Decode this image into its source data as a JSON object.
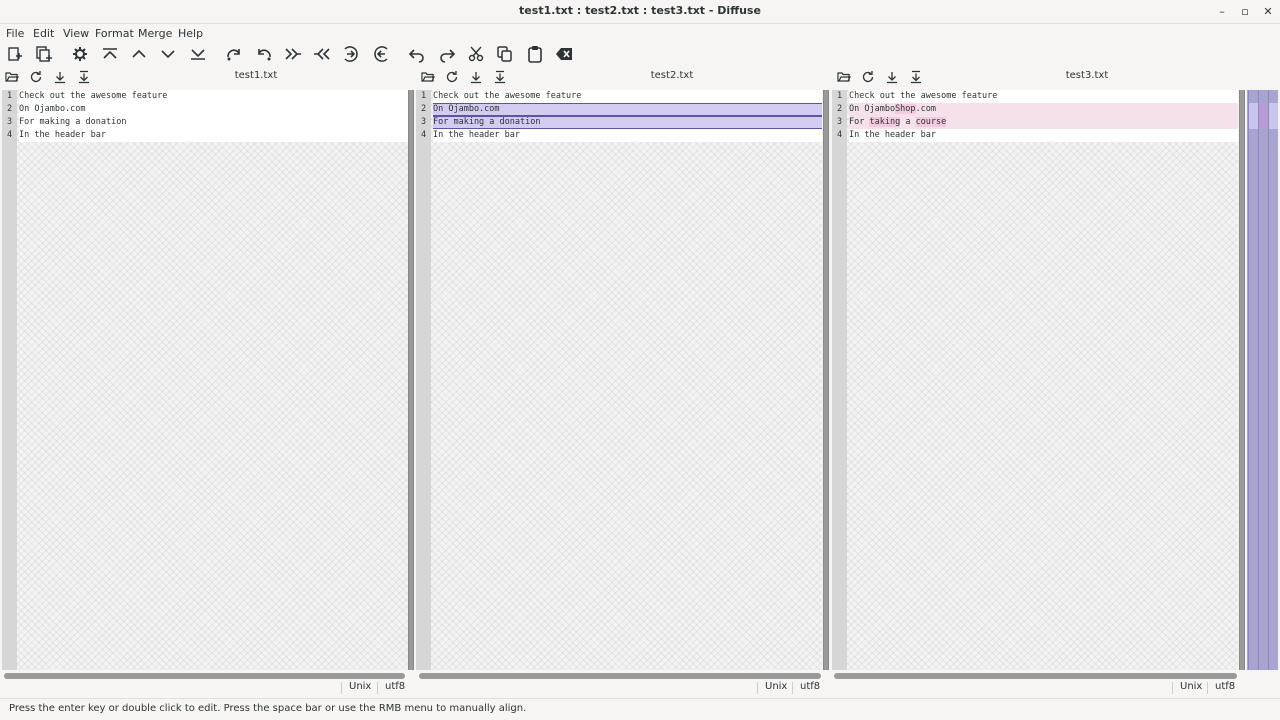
{
  "window": {
    "title": "test1.txt : test2.txt : test3.txt - Diffuse",
    "minimize": "–",
    "maximize": "▫",
    "close": "✕"
  },
  "menu": [
    "File",
    "Edit",
    "View",
    "Format",
    "Merge",
    "Help"
  ],
  "toolbar_icons": [
    "new-2-way-icon",
    "new-3-way-icon",
    "realign-icon",
    "first-difference-icon",
    "previous-difference-icon",
    "next-difference-icon",
    "last-difference-icon",
    "redo-icon",
    "undo-icon",
    "copy-selection-right-icon",
    "copy-selection-left-icon",
    "merge-from-right-icon",
    "merge-from-left-icon",
    "undo-edit-icon",
    "redo-edit-icon",
    "cut-icon",
    "copy-icon",
    "paste-icon",
    "clear-edits-icon"
  ],
  "panes": [
    {
      "filename": "test1.txt",
      "format": "Unix",
      "encoding": "utf8",
      "lines": [
        {
          "num": "1",
          "text": "Check out the awesome feature"
        },
        {
          "num": "2",
          "text": "On Ojambo.com"
        },
        {
          "num": "3",
          "text": "For making a donation"
        },
        {
          "num": "4",
          "text": "In the header bar"
        }
      ]
    },
    {
      "filename": "test2.txt",
      "format": "Unix",
      "encoding": "utf8",
      "lines": [
        {
          "num": "1",
          "text": "Check out the awesome feature"
        },
        {
          "num": "2",
          "text": "On Ojambo.com"
        },
        {
          "num": "3",
          "text": "For making a donation"
        },
        {
          "num": "4",
          "text": "In the header bar"
        }
      ]
    },
    {
      "filename": "test3.txt",
      "format": "Unix",
      "encoding": "utf8",
      "lines": [
        {
          "num": "1",
          "text": "Check out the awesome feature"
        },
        {
          "num": "2",
          "text": "On OjamboShop.com",
          "pre": "On Ojambo",
          "hl": "Shop",
          "post": ".com"
        },
        {
          "num": "3",
          "text": "For taking a course",
          "pre": "For ",
          "hl": "taking",
          "mid": " a ",
          "hl2": "course"
        },
        {
          "num": "4",
          "text": "In the header bar"
        }
      ]
    }
  ],
  "status": "Press the enter key or double click to edit. Press the space bar or use the RMB menu to manually align.",
  "colors": {
    "changed_line": "#d4cbf0",
    "changed_line_alt": "#f5e1ec",
    "changed_chars": "#f2c9de",
    "overview": "#a7a4cf"
  }
}
